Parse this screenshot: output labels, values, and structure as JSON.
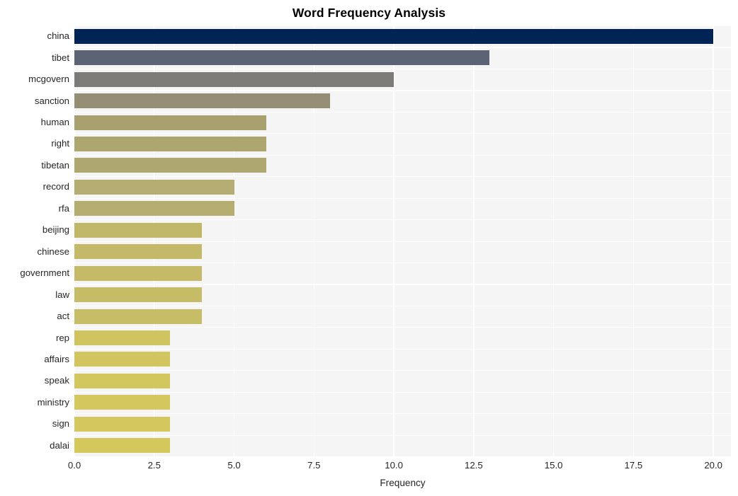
{
  "chart_data": {
    "type": "bar",
    "orientation": "horizontal",
    "title": "Word Frequency Analysis",
    "xlabel": "Frequency",
    "ylabel": "",
    "xlim": [
      0,
      20.55
    ],
    "xticks": [
      0.0,
      2.5,
      5.0,
      7.5,
      10.0,
      12.5,
      15.0,
      17.5,
      20.0
    ],
    "xtick_labels": [
      "0.0",
      "2.5",
      "5.0",
      "7.5",
      "10.0",
      "12.5",
      "15.0",
      "17.5",
      "20.0"
    ],
    "grid": true,
    "legend": null,
    "categories": [
      "china",
      "tibet",
      "mcgovern",
      "sanction",
      "human",
      "right",
      "tibetan",
      "record",
      "rfa",
      "beijing",
      "chinese",
      "government",
      "law",
      "act",
      "rep",
      "affairs",
      "speak",
      "ministry",
      "sign",
      "dalai"
    ],
    "values": [
      20,
      13,
      10,
      8,
      6,
      6,
      6,
      5,
      5,
      4,
      4,
      4,
      4,
      4,
      3,
      3,
      3,
      3,
      3,
      3
    ],
    "bar_colors": [
      "#012456",
      "#5c6374",
      "#7c7b78",
      "#938e74",
      "#a8a06e",
      "#ada66f",
      "#aea770",
      "#b4ac70",
      "#b5ad70",
      "#c1b769",
      "#c3b968",
      "#c4ba68",
      "#c6bc67",
      "#c7bd66",
      "#d0c460",
      "#d1c55f",
      "#d2c65f",
      "#d3c75e",
      "#d3c75e",
      "#d4c85d"
    ],
    "colormap": "cividis",
    "plot_background": "#f5f5f5",
    "grid_color": "#ffffff",
    "figure_background": "#ffffff"
  }
}
